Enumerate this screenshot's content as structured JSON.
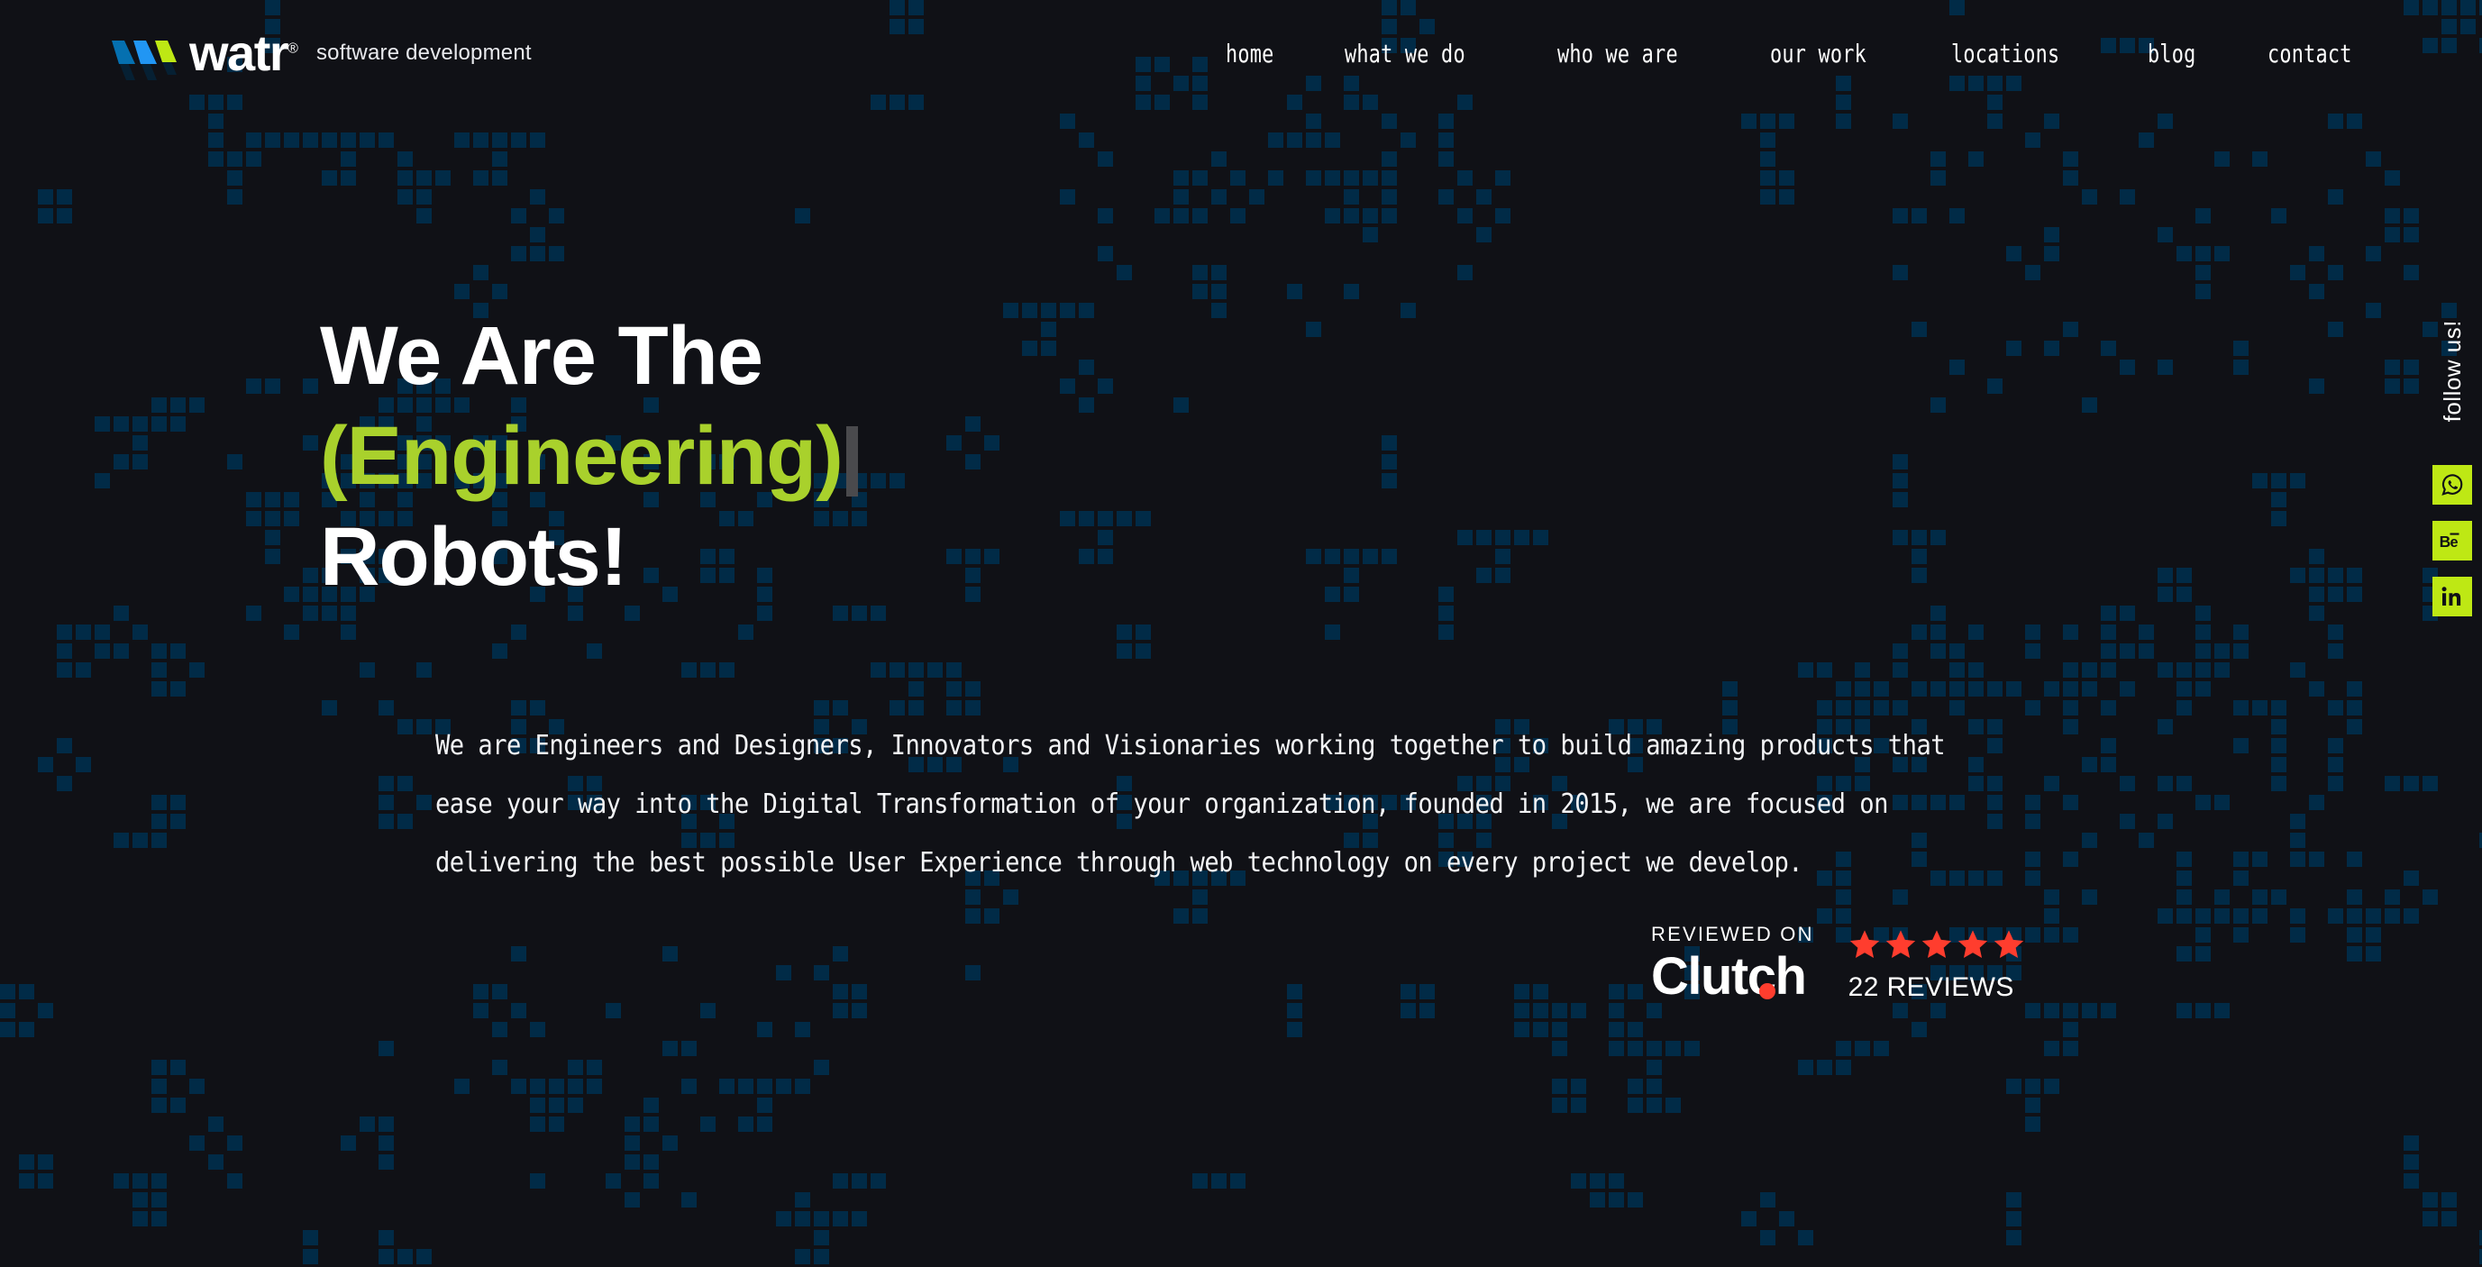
{
  "site": {
    "background_color": "#101116",
    "accent_green": "#a9d12c",
    "social_green": "#bee814",
    "pattern_color": "#012b47",
    "star_color": "#ff3d2e"
  },
  "header": {
    "logo": {
      "wordmark": "watr",
      "registered_mark": "®",
      "tagline": "software development",
      "mark_colors": [
        "#0570b0",
        "#2196f3",
        "#bee814"
      ],
      "mark_shadow_color": "#062033"
    },
    "nav": [
      {
        "label": "home"
      },
      {
        "label": "what we do"
      },
      {
        "label": "who we are"
      },
      {
        "label": "our work"
      },
      {
        "label": "locations"
      },
      {
        "label": "blog"
      },
      {
        "label": "contact"
      }
    ]
  },
  "hero": {
    "heading_line1": "We Are The",
    "heading_line2_accent": "(Engineering)",
    "heading_line3": "Robots!",
    "paragraph_lines": [
      "We are Engineers and Designers, Innovators and Visionaries working together to build amazing products that",
      "ease your way into the Digital Transformation of your organization, founded in 2015, we are focused on",
      "delivering the best possible User Experience through web technology on every project we develop."
    ]
  },
  "clutch_badge": {
    "reviewed_on": "REVIEWED ON",
    "brand": "Clutch",
    "rating_stars": 5,
    "reviews_label": "22 REVIEWS"
  },
  "follow_rail": {
    "label": "follow us!",
    "items": [
      {
        "name": "whatsapp",
        "icon": "whatsapp-icon"
      },
      {
        "name": "behance",
        "icon": "behance-icon"
      },
      {
        "name": "linkedin",
        "icon": "linkedin-icon"
      }
    ]
  }
}
